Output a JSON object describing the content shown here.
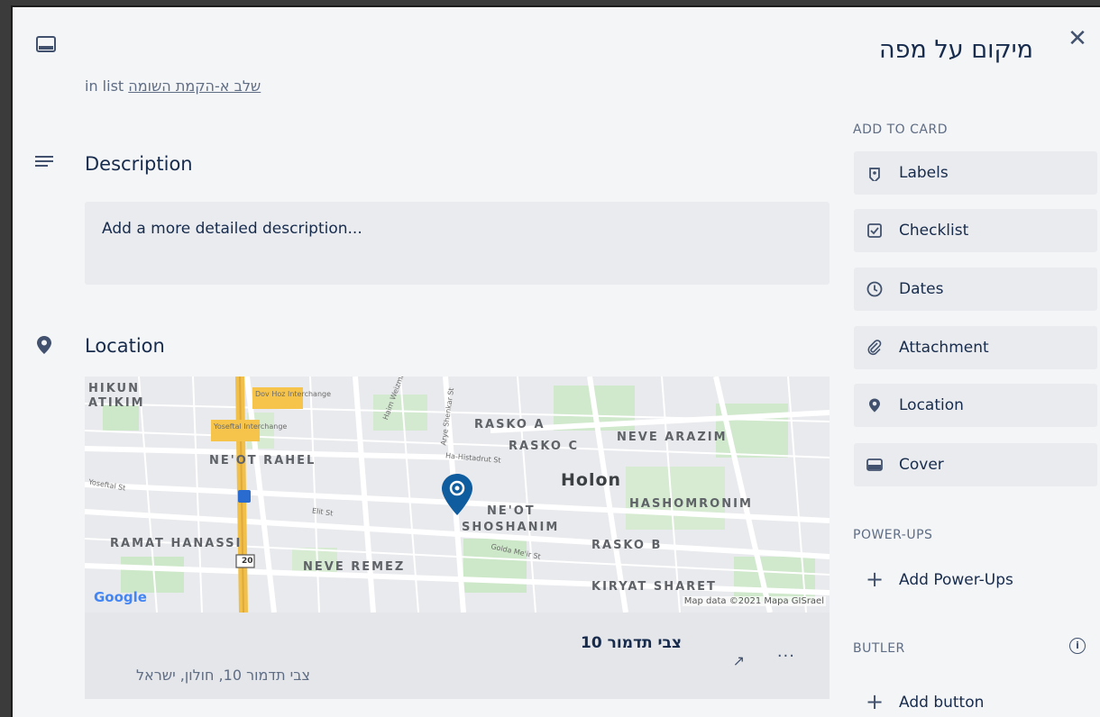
{
  "card": {
    "title": "מיקום על מפה",
    "close_glyph": "✕",
    "in_list_prefix": "in list",
    "list_name": "שלב א-הקמת השומה"
  },
  "description": {
    "heading": "Description",
    "placeholder": "Add a more detailed description..."
  },
  "location": {
    "heading": "Location",
    "map": {
      "labels": [
        "HIKUN",
        "ATIKIM",
        "NE'OT RAHEL",
        "RASKO A",
        "RASKO C",
        "NEVE ARAZIM",
        "Holon",
        "NE'OT",
        "SHOSHANIM",
        "HASHOMRONIM",
        "RAMAT HANASSI",
        "NEVE REMEZ",
        "RASKO B",
        "KIRYAT SHARET"
      ],
      "streets": [
        "Dov Hoz Interchange",
        "Yoseftal Interchange",
        "Haim Weizman St",
        "Arye Shenkar St",
        "Ha-Histadrut St",
        "Yoseftal St",
        "Elit St",
        "Golda Me'ir St",
        "Elit St"
      ],
      "shield_20": "20",
      "attribution": "Map data ©2021 Mapa GISrael",
      "google": "Google"
    },
    "place_name": "צבי תדמור 10",
    "place_address": "צבי תדמור 10, חולון, ישראל",
    "open_glyph": "↗",
    "more_glyph": "···"
  },
  "sidebar": {
    "add_to_card_label": "ADD TO CARD",
    "buttons": [
      {
        "label": "Labels",
        "icon": "tag-icon"
      },
      {
        "label": "Checklist",
        "icon": "checklist-icon"
      },
      {
        "label": "Dates",
        "icon": "clock-icon"
      },
      {
        "label": "Attachment",
        "icon": "paperclip-icon"
      },
      {
        "label": "Location",
        "icon": "location-pin-icon"
      },
      {
        "label": "Cover",
        "icon": "cover-icon"
      }
    ],
    "powerups_label": "POWER-UPS",
    "add_powerups": "Add Power-Ups",
    "butler_label": "BUTLER",
    "add_button": "Add button",
    "plus_glyph": "+"
  },
  "colors": {
    "accent_pin": "#0f5c9e",
    "highway": "#f4c247",
    "park": "#c8e6c3"
  }
}
